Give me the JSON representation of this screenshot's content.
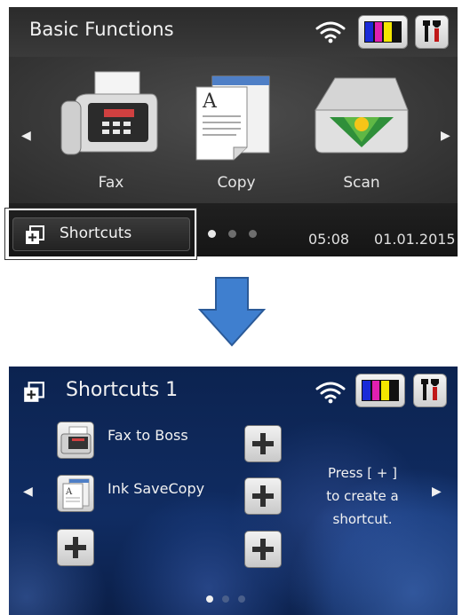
{
  "basic_screen": {
    "title": "Basic Functions",
    "functions": [
      {
        "label": "Fax",
        "icon": "fax-icon"
      },
      {
        "label": "Copy",
        "icon": "copy-icon"
      },
      {
        "label": "Scan",
        "icon": "scan-icon"
      }
    ],
    "shortcuts_label": "Shortcuts",
    "page_dots": 3,
    "active_dot": 1,
    "time": "05:08",
    "date": "01.01.2015",
    "ink_colors": [
      "#1a2bd8",
      "#e020b0",
      "#f3e600",
      "#111111"
    ]
  },
  "shortcuts_screen": {
    "title": "Shortcuts 1",
    "items": [
      {
        "label": "Fax to Boss",
        "icon": "fax-icon"
      },
      {
        "label": "Ink SaveCopy",
        "icon": "copy-icon"
      }
    ],
    "help_text": [
      "Press [ + ]",
      "to create a",
      "shortcut."
    ],
    "page_dots": 3,
    "active_dot": 1
  },
  "colors": {
    "screen_dark": "#323232",
    "shortcuts_bg": "#102c62",
    "arrow_blue": "#3f7fcf"
  }
}
